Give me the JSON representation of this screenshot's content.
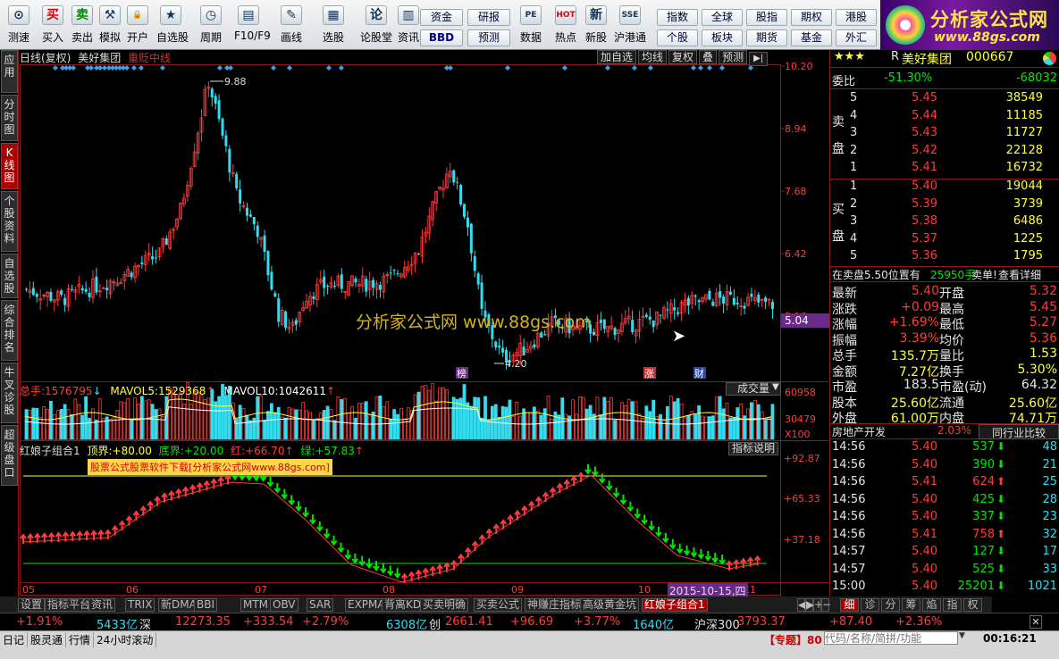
{
  "toolbar": {
    "buttons": [
      {
        "label": "测速",
        "icon": "gauge-icon",
        "glyph": "⊙"
      },
      {
        "label": "买入",
        "icon": "buy-icon",
        "glyph": "买"
      },
      {
        "label": "卖出",
        "icon": "sell-icon",
        "glyph": "卖"
      },
      {
        "label": "模拟",
        "icon": "hammer-icon",
        "glyph": "⚒"
      },
      {
        "label": "开户",
        "icon": "lock-icon",
        "glyph": "🔒"
      },
      {
        "label": "自选股",
        "icon": "star-list-icon",
        "glyph": "★"
      },
      {
        "label": "周期",
        "icon": "clock-icon",
        "glyph": "◷"
      },
      {
        "label": "F10/F9",
        "icon": "window-icon",
        "glyph": "▤"
      },
      {
        "label": "画线",
        "icon": "pencil-icon",
        "glyph": "✎"
      },
      {
        "label": "选股",
        "icon": "chart-select-icon",
        "glyph": "▦"
      },
      {
        "label": "论股堂",
        "icon": "forum-icon",
        "glyph": "论"
      },
      {
        "label": "资讯",
        "icon": "news-icon",
        "glyph": "▥"
      },
      {
        "label": "数据",
        "icon": "pe-icon",
        "glyph": "PE"
      },
      {
        "label": "热点",
        "icon": "hot-icon",
        "glyph": "HOT"
      },
      {
        "label": "新股",
        "icon": "new-stock-icon",
        "glyph": "新"
      },
      {
        "label": "沪港通",
        "icon": "sse-hk-icon",
        "glyph": "SSE"
      }
    ],
    "quick1": [
      "资金",
      "BBD",
      "研报",
      "预测"
    ],
    "quick2": [
      "指数",
      "个股",
      "全球",
      "板块",
      "股指",
      "期货",
      "期权",
      "基金",
      "港股",
      "外汇"
    ]
  },
  "logo": {
    "title": "分析家公式网",
    "url": "www.88gs.com"
  },
  "left_tabs": [
    "应用",
    "分时图",
    "K线图",
    "个股资料",
    "自选股",
    "综合排名",
    "牛叉诊股",
    "超级盘口"
  ],
  "chart": {
    "header": {
      "period": "日线(复权)",
      "name": "美好集团",
      "indicator": "重贬中线",
      "buttons": [
        "加自选",
        "均线",
        "复权",
        "叠",
        "预测"
      ]
    },
    "price_axis": [
      "10.20",
      "8.94",
      "7.68",
      "6.42",
      "5.16"
    ],
    "current_price_tag": "5.04",
    "hi_label": "9.88",
    "lo_label": "4.20",
    "markers": [
      "榜",
      "涨",
      "财"
    ],
    "watermark": "分析家公式网 www.88gs.com",
    "volume": {
      "total_label": "总手:",
      "total": "1576795",
      "ma5_label": "MAVOL5:",
      "ma5": "1529368",
      "ma10_label": "MAVOL10:",
      "ma10": "1042611",
      "selector": "成交量",
      "axis": [
        "60958",
        "30479",
        "X100"
      ]
    },
    "indicator": {
      "name": "红娘子组合1",
      "top_label": "顶界:",
      "top": "+80.00",
      "bottom_label": "底界:",
      "bottom": "+20.00",
      "red_label": "红:",
      "red": "+66.70",
      "green_label": "绿:",
      "green": "+57.83",
      "button": "指标说明",
      "banner": "股票公式股票软件下载[分析家公式网www.88gs.com]",
      "axis": [
        "+92.87",
        "+65.33",
        "+37.18"
      ]
    },
    "date_axis": [
      "05",
      "06",
      "07",
      "08",
      "09",
      "10",
      "11"
    ],
    "date_highlight": "2015-10-15,四"
  },
  "quote": {
    "stars": "★★★",
    "code_prefix": "R",
    "name": "美好集团",
    "code": "000667",
    "weibi_label": "委比",
    "weibi": "-51.30%",
    "weicha": "-68032",
    "sell_label": "卖盘",
    "buy_label": "买盘",
    "sell": [
      [
        "5",
        "5.45",
        "38549"
      ],
      [
        "4",
        "5.44",
        "11185"
      ],
      [
        "3",
        "5.43",
        "11727"
      ],
      [
        "2",
        "5.42",
        "22128"
      ],
      [
        "1",
        "5.41",
        "16732"
      ]
    ],
    "buy": [
      [
        "1",
        "5.40",
        "19044"
      ],
      [
        "2",
        "5.39",
        "3739"
      ],
      [
        "3",
        "5.38",
        "6486"
      ],
      [
        "4",
        "5.37",
        "1225"
      ],
      [
        "5",
        "5.36",
        "1795"
      ]
    ],
    "notice_a": "在卖盘5.50位置有",
    "notice_b": "25950手",
    "notice_c": "卖单!",
    "notice_d": "查看详细",
    "stats": [
      [
        "最新",
        "5.40",
        "开盘",
        "5.32"
      ],
      [
        "涨跌",
        "+0.09",
        "最高",
        "5.45"
      ],
      [
        "涨幅",
        "+1.69%",
        "最低",
        "5.27"
      ],
      [
        "振幅",
        "3.39%",
        "均价",
        "5.36"
      ],
      [
        "总手",
        "135.7万",
        "量比",
        "1.53"
      ],
      [
        "金额",
        "7.27亿",
        "换手",
        "5.30%"
      ],
      [
        "市盈",
        "183.5",
        "市盈(动)",
        "64.32"
      ],
      [
        "股本",
        "25.60亿",
        "流通",
        "25.60亿"
      ],
      [
        "外盘",
        "61.00万",
        "内盘",
        "74.71万"
      ]
    ],
    "sector": "房地产开发",
    "sector_pct": "2.03%",
    "compare": "同行业比较",
    "ticks": [
      [
        "14:56",
        "5.40",
        "537",
        "48",
        "down"
      ],
      [
        "14:56",
        "5.40",
        "390",
        "21",
        "down"
      ],
      [
        "14:56",
        "5.41",
        "624",
        "25",
        "up"
      ],
      [
        "14:56",
        "5.40",
        "425",
        "28",
        "down"
      ],
      [
        "14:56",
        "5.40",
        "337",
        "23",
        "down"
      ],
      [
        "14:56",
        "5.41",
        "758",
        "32",
        "up"
      ],
      [
        "14:57",
        "5.40",
        "127",
        "17",
        "down"
      ],
      [
        "14:57",
        "5.40",
        "525",
        "33",
        "down"
      ],
      [
        "15:00",
        "5.40",
        "25201",
        "1021",
        "down"
      ]
    ],
    "bottom_tabs": [
      "细",
      "诊",
      "分",
      "筹",
      "焰",
      "指",
      "权"
    ]
  },
  "bottom_tabs": [
    "设置",
    "指标平台",
    "资讯",
    "TRIX",
    "新DMA",
    "BBI",
    "MTM",
    "OBV",
    "SAR",
    "EXPMA",
    "背离KDJ",
    "买卖明确",
    "买卖公式",
    "神赚庄指标",
    "高级黄金坑",
    "红娘子组合1"
  ],
  "ticker": [
    {
      "t": "+1.91%",
      "c": "red"
    },
    {
      "t": "5433亿",
      "c": "cy"
    },
    {
      "t": "深",
      "c": "wht"
    },
    {
      "t": "12273.35",
      "c": "red"
    },
    {
      "t": "+333.54",
      "c": "red"
    },
    {
      "t": "+2.79%",
      "c": "red"
    },
    {
      "t": "6308亿",
      "c": "cy"
    },
    {
      "t": "创",
      "c": "wht"
    },
    {
      "t": "2661.41",
      "c": "red"
    },
    {
      "t": "+96.69",
      "c": "red"
    },
    {
      "t": "+3.77%",
      "c": "red"
    },
    {
      "t": "1640亿",
      "c": "cy"
    },
    {
      "t": "沪深300",
      "c": "wht"
    },
    {
      "t": "3793.37",
      "c": "red"
    },
    {
      "t": "+87.40",
      "c": "red"
    },
    {
      "t": "+2.36%",
      "c": "red"
    }
  ],
  "status": {
    "items": [
      "日记",
      "股灵通",
      "行情",
      "24小时滚动"
    ],
    "topic": "【专题】80",
    "search_placeholder": "代码/名称/简拼/功能",
    "time": "00:16:21"
  },
  "colors": {
    "up": "#ff3b3b",
    "down": "#34dcef",
    "bg": "#000000",
    "grid": "#8a1a1a"
  }
}
